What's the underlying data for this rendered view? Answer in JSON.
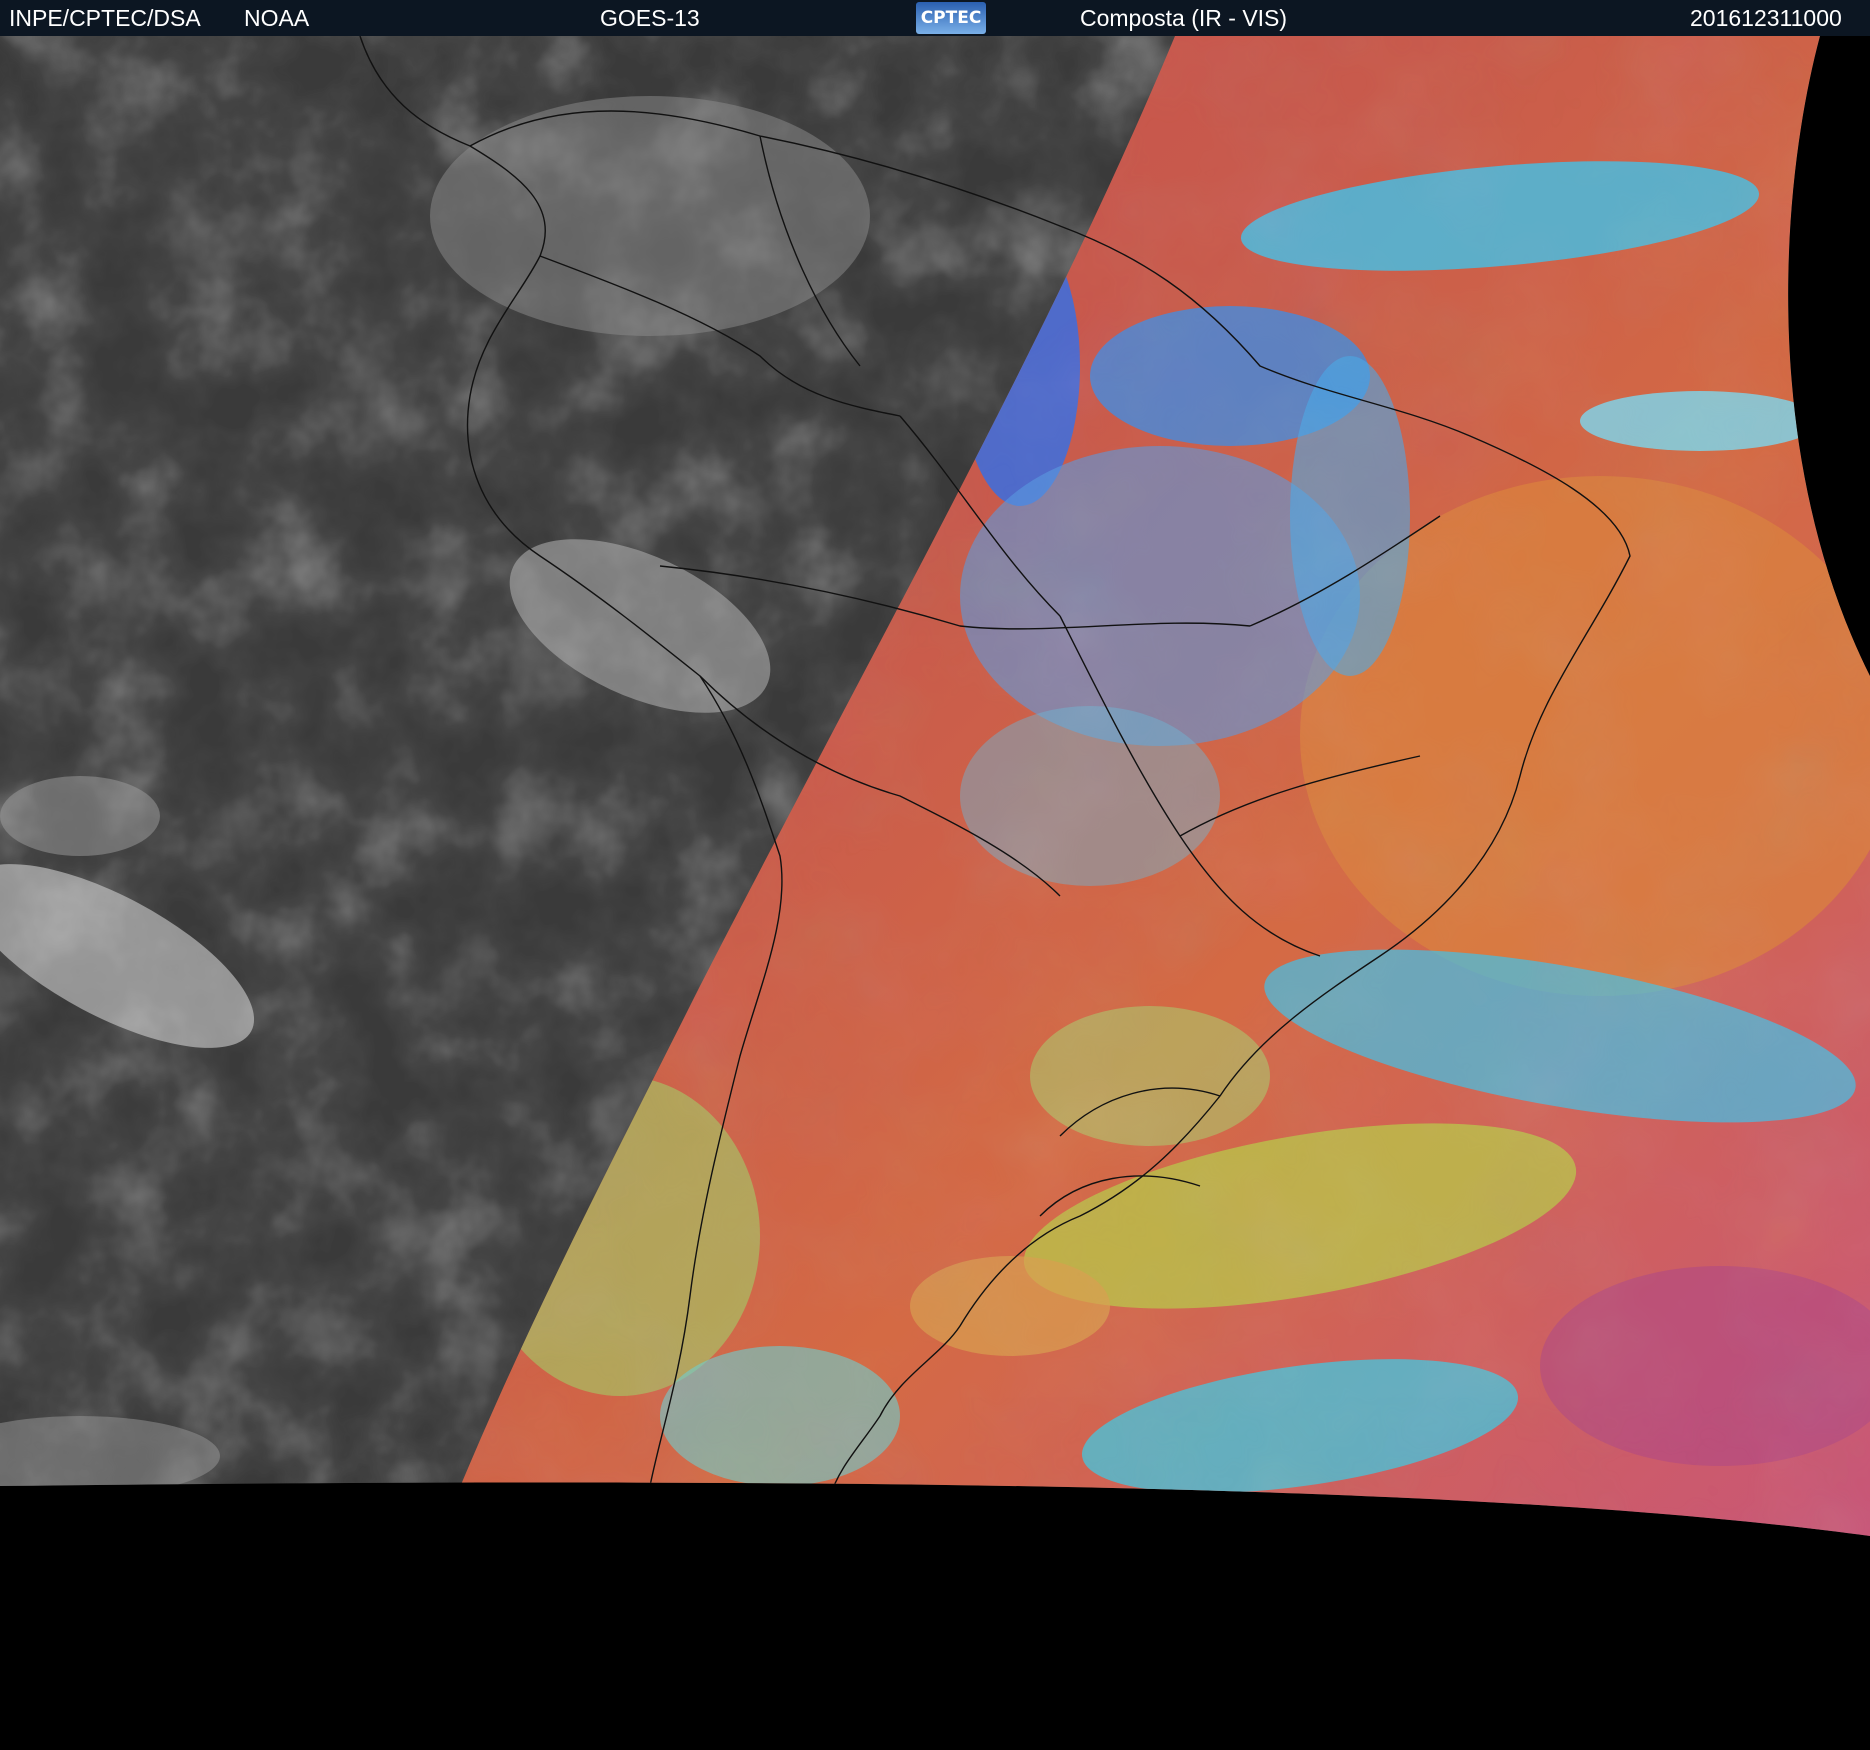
{
  "header": {
    "agency": "INPE/CPTEC/DSA",
    "partner": "NOAA",
    "satellite": "GOES-13",
    "logo_text": "CPTEC",
    "product": "Composta (IR - VIS)",
    "timestamp": "201612311000"
  },
  "colors": {
    "header_bg": "#0c1622",
    "night_ir": "#3c3c3c",
    "composite_red": "#c9504a",
    "composite_orange": "#d9823f",
    "composite_cyan": "#41c2e8",
    "composite_blue": "#3a6fe0",
    "composite_green": "#9dd86a",
    "space": "#000000"
  }
}
